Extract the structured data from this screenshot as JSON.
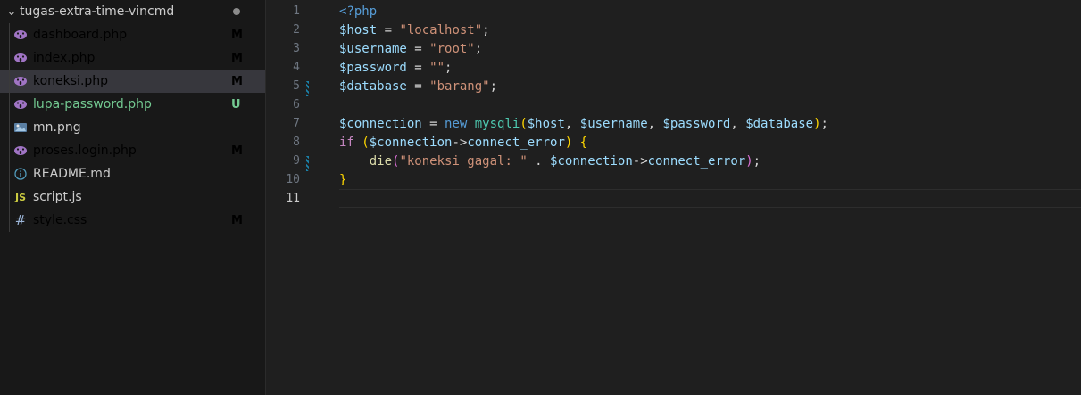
{
  "explorer": {
    "folder_name": "tugas-extra-time-vincmd",
    "files": [
      {
        "name": "dashboard.php",
        "icon": "php-elephant-icon",
        "status": "M",
        "state": "modified"
      },
      {
        "name": "index.php",
        "icon": "php-elephant-icon",
        "status": "M",
        "state": "modified"
      },
      {
        "name": "koneksi.php",
        "icon": "php-elephant-icon",
        "status": "M",
        "state": "modified",
        "selected": true
      },
      {
        "name": "lupa-password.php",
        "icon": "php-elephant-icon",
        "status": "U",
        "state": "untracked"
      },
      {
        "name": "mn.png",
        "icon": "image-icon",
        "status": "",
        "state": "plain"
      },
      {
        "name": "proses.login.php",
        "icon": "php-elephant-icon",
        "status": "M",
        "state": "modified"
      },
      {
        "name": "README.md",
        "icon": "info-icon",
        "status": "",
        "state": "plain"
      },
      {
        "name": "script.js",
        "icon": "js-icon",
        "status": "",
        "state": "plain"
      },
      {
        "name": "style.css",
        "icon": "css-hash-icon",
        "status": "M",
        "state": "modified"
      }
    ]
  },
  "editor": {
    "current_line": 11,
    "lines": [
      {
        "n": "1",
        "tokens": [
          {
            "c": "t-kw",
            "t": "<?php"
          }
        ]
      },
      {
        "n": "2",
        "tokens": [
          {
            "c": "t-var",
            "t": "$host"
          },
          {
            "c": "t-pun",
            "t": " = "
          },
          {
            "c": "t-str",
            "t": "\"localhost\""
          },
          {
            "c": "t-pun",
            "t": ";"
          }
        ]
      },
      {
        "n": "3",
        "tokens": [
          {
            "c": "t-var",
            "t": "$username"
          },
          {
            "c": "t-pun",
            "t": " = "
          },
          {
            "c": "t-str",
            "t": "\"root\""
          },
          {
            "c": "t-pun",
            "t": ";"
          }
        ]
      },
      {
        "n": "4",
        "tokens": [
          {
            "c": "t-var",
            "t": "$password"
          },
          {
            "c": "t-pun",
            "t": " = "
          },
          {
            "c": "t-str",
            "t": "\"\""
          },
          {
            "c": "t-pun",
            "t": ";"
          }
        ]
      },
      {
        "n": "5",
        "mark": true,
        "tokens": [
          {
            "c": "t-var",
            "t": "$database"
          },
          {
            "c": "t-pun",
            "t": " = "
          },
          {
            "c": "t-str",
            "t": "\"barang\""
          },
          {
            "c": "t-pun",
            "t": ";"
          }
        ]
      },
      {
        "n": "6",
        "tokens": []
      },
      {
        "n": "7",
        "tokens": [
          {
            "c": "t-var",
            "t": "$connection"
          },
          {
            "c": "t-pun",
            "t": " = "
          },
          {
            "c": "t-kw",
            "t": "new "
          },
          {
            "c": "t-cls",
            "t": "mysqli"
          },
          {
            "c": "t-br1",
            "t": "("
          },
          {
            "c": "t-var",
            "t": "$host"
          },
          {
            "c": "t-pun",
            "t": ", "
          },
          {
            "c": "t-var",
            "t": "$username"
          },
          {
            "c": "t-pun",
            "t": ", "
          },
          {
            "c": "t-var",
            "t": "$password"
          },
          {
            "c": "t-pun",
            "t": ", "
          },
          {
            "c": "t-var",
            "t": "$database"
          },
          {
            "c": "t-br1",
            "t": ")"
          },
          {
            "c": "t-pun",
            "t": ";"
          }
        ]
      },
      {
        "n": "8",
        "tokens": [
          {
            "c": "t-ctl",
            "t": "if "
          },
          {
            "c": "t-br1",
            "t": "("
          },
          {
            "c": "t-var",
            "t": "$connection"
          },
          {
            "c": "t-pun",
            "t": "->"
          },
          {
            "c": "t-var",
            "t": "connect_error"
          },
          {
            "c": "t-br1",
            "t": ")"
          },
          {
            "c": "t-pun",
            "t": " "
          },
          {
            "c": "t-br1",
            "t": "{"
          }
        ]
      },
      {
        "n": "9",
        "mark": true,
        "tokens": [
          {
            "c": "t-pun",
            "t": "    "
          },
          {
            "c": "t-fn",
            "t": "die"
          },
          {
            "c": "t-br2",
            "t": "("
          },
          {
            "c": "t-str",
            "t": "\"koneksi gagal: \""
          },
          {
            "c": "t-pun",
            "t": " . "
          },
          {
            "c": "t-var",
            "t": "$connection"
          },
          {
            "c": "t-pun",
            "t": "->"
          },
          {
            "c": "t-var",
            "t": "connect_error"
          },
          {
            "c": "t-br2",
            "t": ")"
          },
          {
            "c": "t-pun",
            "t": ";"
          }
        ]
      },
      {
        "n": "10",
        "tokens": [
          {
            "c": "t-br1",
            "t": "}"
          }
        ]
      },
      {
        "n": "11",
        "current": true,
        "tokens": []
      }
    ]
  },
  "colors": {
    "modified": "#e2c08d",
    "untracked": "#73c991",
    "selected_bg": "#37373d",
    "editor_bg": "#1f1f1f",
    "sidebar_bg": "#181818"
  }
}
